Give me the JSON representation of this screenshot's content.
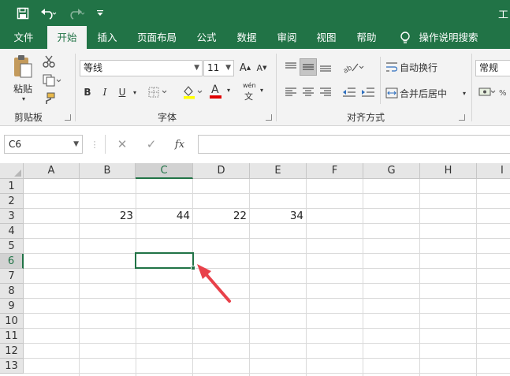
{
  "titlebar": {
    "title": "工",
    "save_icon": "save-icon",
    "undo_icon": "undo-icon",
    "redo_icon": "redo-icon",
    "customize_icon": "customize-qat-icon"
  },
  "tabs": [
    {
      "label": "文件",
      "active": false
    },
    {
      "label": "开始",
      "active": true
    },
    {
      "label": "插入",
      "active": false
    },
    {
      "label": "页面布局",
      "active": false
    },
    {
      "label": "公式",
      "active": false
    },
    {
      "label": "数据",
      "active": false
    },
    {
      "label": "审阅",
      "active": false
    },
    {
      "label": "视图",
      "active": false
    },
    {
      "label": "帮助",
      "active": false
    }
  ],
  "tellme": {
    "label": "操作说明搜索",
    "icon": "lightbulb-icon"
  },
  "ribbon": {
    "clipboard": {
      "label": "剪贴板",
      "paste_label": "粘贴"
    },
    "font": {
      "label": "字体",
      "font_name": "等线",
      "font_size": "11",
      "bold": "B",
      "italic": "I",
      "underline": "U",
      "font_color_glyph": "A",
      "phonetic_glyph": "wén"
    },
    "alignment": {
      "label": "对齐方式",
      "wrap_text": "自动换行",
      "merge_center": "合并后居中"
    },
    "number": {
      "format": "常规"
    }
  },
  "formula_bar": {
    "name_box": "C6",
    "cancel_glyph": "✕",
    "enter_glyph": "✓",
    "fx_glyph": "fx",
    "value": ""
  },
  "grid": {
    "columns": [
      "A",
      "B",
      "C",
      "D",
      "E",
      "F",
      "G",
      "H",
      "I"
    ],
    "rows": [
      "1",
      "2",
      "3",
      "4",
      "5",
      "6",
      "7",
      "8",
      "9",
      "10",
      "11",
      "12",
      "13"
    ],
    "selected_cell": "C6",
    "cells": [
      {
        "ref": "B3",
        "value": "23"
      },
      {
        "ref": "C3",
        "value": "44"
      },
      {
        "ref": "D3",
        "value": "22"
      },
      {
        "ref": "E3",
        "value": "34"
      }
    ]
  },
  "annotation": {
    "arrow_color": "#e8414a"
  },
  "colors": {
    "brand": "#217346",
    "selection": "#217346"
  }
}
